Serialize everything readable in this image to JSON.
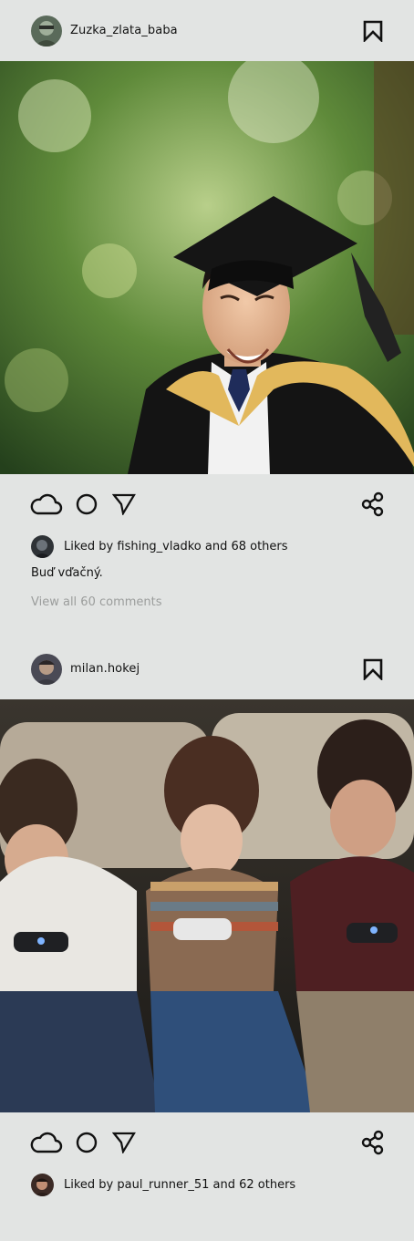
{
  "feed": {
    "posts": [
      {
        "username": "Zuzka_zlata_baba",
        "photo_alt": "Smiling graduate in cap and gown",
        "liked_by_text": "Liked by fishing_vladko and 68 others",
        "caption": "Buď vďačný.",
        "view_comments": "View all 60 comments"
      },
      {
        "username": "milan.hokej",
        "photo_alt": "Three teenagers playing video games on a couch",
        "liked_by_text": "Liked by paul_runner_51 and 62 others"
      }
    ]
  },
  "icons": {
    "like": "cloud-icon",
    "comment": "circle-icon",
    "send": "send-triangle-icon",
    "share": "share-icon",
    "save": "bookmark-icon"
  },
  "colors": {
    "background": "#e2e4e3",
    "text": "#111111",
    "muted": "#9b9d9c"
  }
}
